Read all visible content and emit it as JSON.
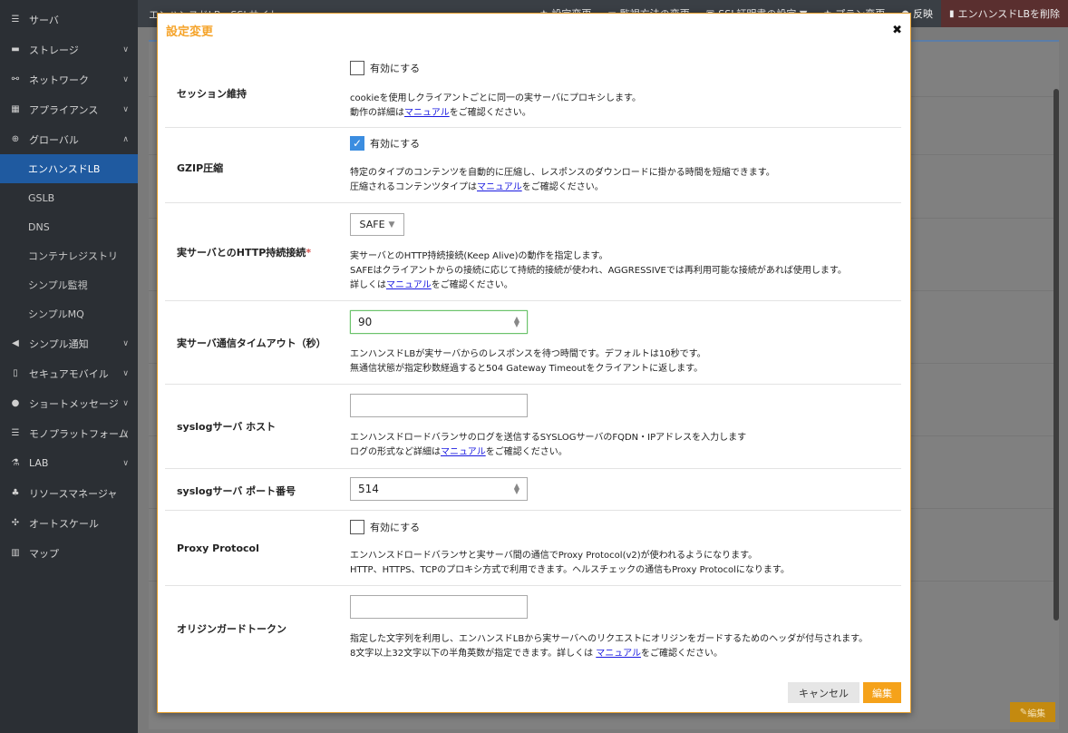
{
  "sidebar": {
    "items": [
      {
        "label": "サーバ",
        "icon": "server-icon",
        "chev": ""
      },
      {
        "label": "ストレージ",
        "icon": "storage-icon",
        "chev": "∨"
      },
      {
        "label": "ネットワーク",
        "icon": "network-icon",
        "chev": "∨"
      },
      {
        "label": "アプライアンス",
        "icon": "appliance-icon",
        "chev": "∨"
      },
      {
        "label": "グローバル",
        "icon": "globe-icon",
        "chev": "∧"
      }
    ],
    "sub": [
      "エンハンスドLB",
      "GSLB",
      "DNS",
      "コンテナレジストリ",
      "シンプル監視",
      "シンプルMQ"
    ],
    "items2": [
      {
        "label": "シンプル通知",
        "icon": "megaphone-icon",
        "chev": "∨"
      },
      {
        "label": "セキュアモバイル",
        "icon": "mobile-icon",
        "chev": "∨"
      },
      {
        "label": "ショートメッセージ",
        "icon": "chat-icon",
        "chev": "∨"
      },
      {
        "label": "モノプラットフォーム",
        "icon": "list-icon",
        "chev": "∨"
      },
      {
        "label": "LAB",
        "icon": "flask-icon",
        "chev": "∨"
      },
      {
        "label": "リソースマネージャ",
        "icon": "sitemap-icon",
        "chev": ""
      },
      {
        "label": "オートスケール",
        "icon": "arrows-icon",
        "chev": ""
      },
      {
        "label": "マップ",
        "icon": "map-icon",
        "chev": ""
      }
    ]
  },
  "topbar": {
    "title": "エンハンスドLB - SSLサイト",
    "buttons": [
      "設定変更",
      "監視方法の変更",
      "SSL証明書の設定 ▼",
      "プラン変更",
      "反映"
    ],
    "delete_label": "エンハンスドLBを削除"
  },
  "background": {
    "edit_label": "編集"
  },
  "modal": {
    "title": "設定変更",
    "close": "✖",
    "session": {
      "label": "セッション維持",
      "checkbox_label": "有効にする",
      "checked": false,
      "desc1": "cookieを使用しクライアントごとに同一の実サーバにプロキシします。",
      "desc2_pre": "動作の詳細は",
      "link": "マニュアル",
      "desc2_post": "をご確認ください。"
    },
    "gzip": {
      "label": "GZIP圧縮",
      "checkbox_label": "有効にする",
      "checked": true,
      "check_mark": "✓",
      "desc1": "特定のタイプのコンテンツを自動的に圧縮し、レスポンスのダウンロードに掛かる時間を短縮できます。",
      "desc2_pre": "圧縮されるコンテンツタイプは",
      "link": "マニュアル",
      "desc2_post": "をご確認ください。"
    },
    "keepalive": {
      "label": "実サーバとのHTTP持続接続",
      "required": "*",
      "value": "SAFE",
      "desc1": "実サーバとのHTTP持続接続(Keep Alive)の動作を指定します。",
      "desc2": "SAFEはクライアントからの接続に応じて持続的接続が使われ、AGGRESSIVEでは再利用可能な接続があれば使用します。",
      "desc3_pre": "詳しくは",
      "link": "マニュアル",
      "desc3_post": "をご確認ください。"
    },
    "timeout": {
      "label": "実サーバ通信タイムアウト（秒）",
      "value": "90",
      "desc1": "エンハンスドLBが実サーバからのレスポンスを待つ時間です。デフォルトは10秒です。",
      "desc2": "無通信状態が指定秒数経過すると504 Gateway Timeoutをクライアントに返します。"
    },
    "syslog_host": {
      "label": "syslogサーバ ホスト",
      "value": "",
      "desc1": "エンハンスドロードバランサのログを送信するSYSLOGサーバのFQDN・IPアドレスを入力します",
      "desc2_pre": "ログの形式など詳細は",
      "link": "マニュアル",
      "desc2_post": "をご確認ください。"
    },
    "syslog_port": {
      "label": "syslogサーバ ポート番号",
      "value": "514"
    },
    "proxy": {
      "label": "Proxy Protocol",
      "checkbox_label": "有効にする",
      "checked": false,
      "desc1": "エンハンスドロードバランサと実サーバ間の通信でProxy Protocol(v2)が使われるようになります。",
      "desc2": "HTTP、HTTPS、TCPのプロキシ方式で利用できます。ヘルスチェックの通信もProxy Protocolになります。"
    },
    "origin": {
      "label": "オリジンガードトークン",
      "value": "",
      "desc1": "指定した文字列を利用し、エンハンスドLBから実サーバへのリクエストにオリジンをガードするためのヘッダが付与されます。",
      "desc2_pre": "8文字以上32文字以下の半角英数が指定できます。詳しくは ",
      "link": "マニュアル",
      "desc2_post": "をご確認ください。"
    },
    "cancel_label": "キャンセル",
    "submit_label": "編集"
  }
}
